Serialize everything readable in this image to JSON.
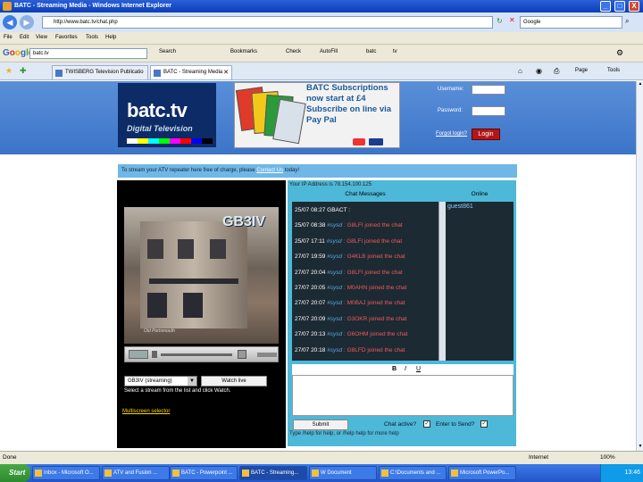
{
  "window": {
    "title": "BATC - Streaming Media - Windows Internet Explorer",
    "minimize": "_",
    "maximize": "□",
    "close": "X"
  },
  "addressbar": {
    "url": "http://www.batc.tv/chat.php",
    "search_value": "Google"
  },
  "menu": [
    "File",
    "Edit",
    "View",
    "Favorites",
    "Tools",
    "Help"
  ],
  "google_toolbar": {
    "logo": "Google",
    "search_value": "batc.tv",
    "buttons": [
      "Search",
      "Bookmarks",
      "Check",
      "AutoFill",
      "batc",
      "tv"
    ]
  },
  "tabs": [
    {
      "label": "TWISBERG Television Publicatio"
    },
    {
      "label": "BATC - Streaming Media",
      "active": true
    }
  ],
  "command_bar": {
    "page": "Page",
    "tools": "Tools"
  },
  "header": {
    "logo_title": "batc.tv",
    "logo_subtitle": "Digital Television",
    "ad_text": "BATC Subscriptions now start at £4 Subscribe on line via Pay Pal",
    "username_label": "Username:",
    "password_label": "Password:",
    "forgot_label": "Forgot login?",
    "login_button": "Login",
    "color_bars": [
      "#ffffff",
      "#ffff00",
      "#00ffff",
      "#00ff00",
      "#ff00ff",
      "#ff0000",
      "#0000ff",
      "#000000"
    ]
  },
  "infobar": {
    "text": "To stream your ATV repeater here free of charge, please",
    "link": "Contact Us",
    "text_after": "today!"
  },
  "player": {
    "channel_overlay": "GB3IV",
    "caption": "Old Portsmouth",
    "channel_select": "GB3IV (streaming)",
    "watch_button": "Watch live",
    "select_hint": "Select a stream from the list and click Watch.",
    "multiscreen_link": "Multiscreen selector"
  },
  "chat": {
    "ip_text": "Your IP Address is 78.154.100.125",
    "messages_header": "Chat Messages",
    "online_header": "Online",
    "online_users": [
      "guest861"
    ],
    "messages": [
      {
        "ts": "25/07 08:27",
        "nick": "GBACT",
        "body": ":",
        "sys": false
      },
      {
        "ts": "25/07 08:38",
        "nick": "#sysd",
        "body": ": G8LFI joined the chat"
      },
      {
        "ts": "25/07 17:11",
        "nick": "#sysd",
        "body": ": G8LFI joined the chat"
      },
      {
        "ts": "27/07 19:59",
        "nick": "#sysd",
        "body": ": G4KLB joined the chat"
      },
      {
        "ts": "27/07 20:04",
        "nick": "#sysd",
        "body": ": G8LFI joined the chat"
      },
      {
        "ts": "27/07 20:05",
        "nick": "#sysd",
        "body": ": M0AHN joined the chat"
      },
      {
        "ts": "27/07 20:07",
        "nick": "#sysd",
        "body": ": M0BAJ joined the chat"
      },
      {
        "ts": "27/07 20:09",
        "nick": "#sysd",
        "body": ": G3OKR joined the chat"
      },
      {
        "ts": "27/07 20:13",
        "nick": "#sysd",
        "body": ": G6OHM joined the chat"
      },
      {
        "ts": "27/07 20:18",
        "nick": "#sysd",
        "body": ": G8LFD joined the chat"
      }
    ],
    "format_bold": "B",
    "format_italic": "I",
    "format_underline": "U",
    "submit_button": "Submit",
    "chat_active_label": "Chat active?",
    "enter_send_label": "Enter to Send?",
    "checkbox_mark": "✓",
    "help_text": "Type /help for help, or /help help for more help"
  },
  "statusbar": {
    "status": "Done",
    "zone": "Internet",
    "zoom": "100%"
  },
  "taskbar": {
    "start": "Start",
    "tasks": [
      {
        "label": "Inbox - Microsoft O..."
      },
      {
        "label": "ATV and Fusion ..."
      },
      {
        "label": "BATC - Powerpoint ..."
      },
      {
        "label": "BATC - Streaming...",
        "active": true
      },
      {
        "label": "W Document"
      },
      {
        "label": "C:\\Documents and ..."
      },
      {
        "label": "Microsoft PowerPo..."
      }
    ],
    "clock": "13:46"
  }
}
